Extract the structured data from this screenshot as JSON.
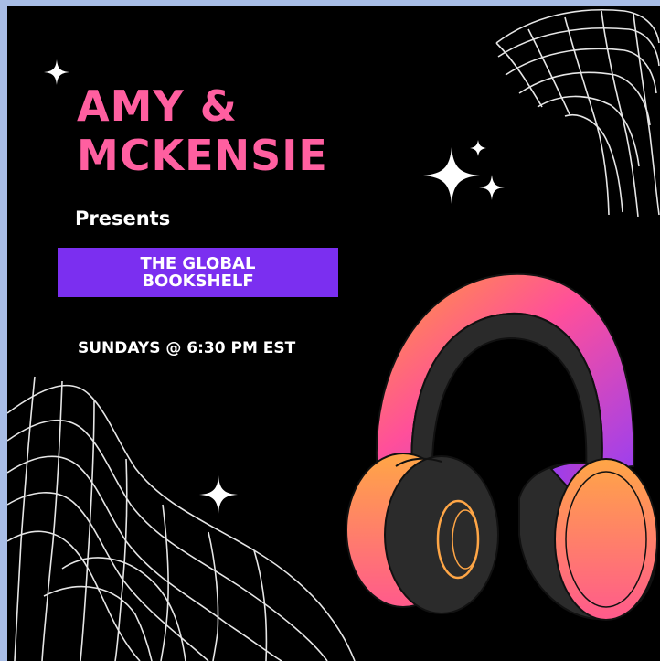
{
  "header": {
    "title_line1": "AMY &",
    "title_line2": "MCKENSIE",
    "presents": "Presents"
  },
  "banner": {
    "line1": "THE GLOBAL",
    "line2": "BOOKSHELF"
  },
  "schedule": "SUNDAYS @ 6:30 PM EST",
  "colors": {
    "frame": "#a8bde6",
    "background": "#000000",
    "title_pink": "#ff5fa0",
    "banner_purple": "#7b2ff0",
    "headphone_orange": "#ffa646",
    "headphone_magenta": "#e8398b",
    "headphone_purple": "#9a3ff0"
  },
  "icons": [
    "sparkle-icon",
    "headphones-icon",
    "wireframe-mesh-icon"
  ]
}
